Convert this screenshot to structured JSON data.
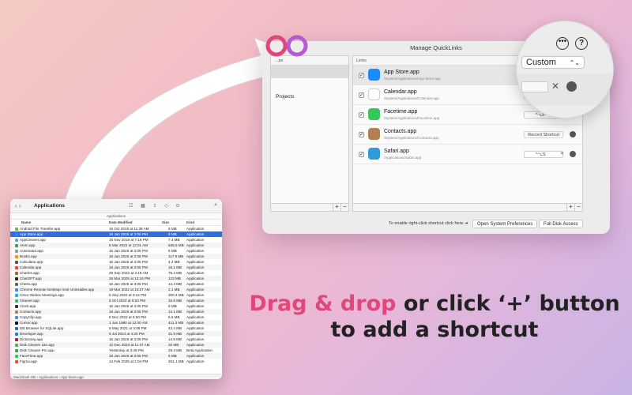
{
  "quicklinks": {
    "title": "Manage QuickLinks",
    "categories_header": "…ps",
    "categories": [
      {
        "label": "",
        "selected": true
      },
      {
        "label": "",
        "selected": false
      },
      {
        "label": "Projects",
        "selected": false
      }
    ],
    "links_header": "Links",
    "links": [
      {
        "name": "App Store.app",
        "path": "/System/Applications/App Store.app",
        "checked": true,
        "shortcut": "",
        "selected": true,
        "icon_color": "#1a8cff"
      },
      {
        "name": "Calendar.app",
        "path": "/System/Applications/Calendar.app",
        "checked": true,
        "shortcut": "",
        "selected": false,
        "icon_color": "#ffffff"
      },
      {
        "name": "Facetime.app",
        "path": "/System/Applications/Facetime.app",
        "checked": true,
        "shortcut": "^⌥F",
        "selected": false,
        "icon_color": "#34c759"
      },
      {
        "name": "Contacts.app",
        "path": "/System/Applications/Contacts.app",
        "checked": true,
        "shortcut": "Record Shortcut",
        "selected": false,
        "icon_color": "#b08050"
      },
      {
        "name": "Safari.app",
        "path": "/Applications/Safari.app",
        "checked": true,
        "shortcut": "^⌥S",
        "selected": false,
        "icon_color": "#2d9cdb"
      }
    ],
    "footer_text": "To enable right-click shortcut click here ➔",
    "open_prefs_label": "Open System Preferences",
    "full_disk_label": "Full Disk Access",
    "plus": "+",
    "minus": "−"
  },
  "zoom": {
    "more_icon": "•••",
    "help_icon": "?",
    "preset_value": "Custom",
    "clear_icon": "✕"
  },
  "finder": {
    "title": "Applications",
    "path_bar": "Applications",
    "columns": [
      "Name",
      "Date Modified",
      "Size",
      "Kind"
    ],
    "status_path": "Macintosh HD › Applications › App Store.app",
    "rows": [
      {
        "name": "Android File Transfer.app",
        "date": "16 Oct 2018 at 11:38 AM",
        "size": "6 MB",
        "kind": "Application",
        "sel": false,
        "color": "#7cb342"
      },
      {
        "name": "App Store.app",
        "date": "16 Jan 2025 at 3:05 PM",
        "size": "8 MB",
        "kind": "Application",
        "sel": true,
        "color": "#1a8cff"
      },
      {
        "name": "AppCleaner.app",
        "date": "16 Nov 2019 at 7:18 PM",
        "size": "7.4 MB",
        "kind": "Application",
        "sel": false,
        "color": "#5aa0e0"
      },
      {
        "name": "Atom.app",
        "date": "8 Mar 2022 at 12:01 AM",
        "size": "638.6 MB",
        "kind": "Application",
        "sel": false,
        "color": "#3d9970"
      },
      {
        "name": "Automator.app",
        "date": "16 Jan 2025 at 3:05 PM",
        "size": "5 MB",
        "kind": "Application",
        "sel": false,
        "color": "#999999"
      },
      {
        "name": "Books.app",
        "date": "16 Jan 2025 at 3:05 PM",
        "size": "117.9 MB",
        "kind": "Application",
        "sel": false,
        "color": "#ff9500"
      },
      {
        "name": "Calculator.app",
        "date": "16 Jan 2025 at 3:05 PM",
        "size": "4.2 MB",
        "kind": "Application",
        "sel": false,
        "color": "#555555"
      },
      {
        "name": "Calendar.app",
        "date": "16 Jan 2025 at 3:05 PM",
        "size": "16.1 MB",
        "kind": "Application",
        "sel": false,
        "color": "#ff3b30"
      },
      {
        "name": "Charles.app",
        "date": "29 Sep 2022 at 2:15 AM",
        "size": "75.4 MB",
        "kind": "Application",
        "sel": false,
        "color": "#8e6c3e"
      },
      {
        "name": "ChatGPT.app",
        "date": "26 Mar 2025 at 12:16 PM",
        "size": "123 MB",
        "kind": "Application",
        "sel": false,
        "color": "#222222"
      },
      {
        "name": "Chess.app",
        "date": "16 Jan 2025 at 3:05 PM",
        "size": "14.4 MB",
        "kind": "Application",
        "sel": false,
        "color": "#666666"
      },
      {
        "name": "Chrome Remote Desktop Host Uninstaller.app",
        "date": "19 Mar 2022 at 10:27 AM",
        "size": "2.1 MB",
        "kind": "Application",
        "sel": false,
        "color": "#4285f4"
      },
      {
        "name": "Cisco Webex Meetings.app",
        "date": "6 Sep 2022 at 3:12 PM",
        "size": "300.4 MB",
        "kind": "Application",
        "sel": false,
        "color": "#00bceb"
      },
      {
        "name": "Cleaner.app",
        "date": "6 Oct 2023 at 9:53 PM",
        "size": "15.5 MB",
        "kind": "Application",
        "sel": false,
        "color": "#3cb371"
      },
      {
        "name": "Clock.app",
        "date": "16 Jan 2025 at 3:05 PM",
        "size": "9 MB",
        "kind": "Application",
        "sel": false,
        "color": "#333333"
      },
      {
        "name": "Contacts.app",
        "date": "16 Jan 2025 at 3:05 PM",
        "size": "14.1 MB",
        "kind": "Application",
        "sel": false,
        "color": "#b08050"
      },
      {
        "name": "CopyClip.app",
        "date": "8 Dec 2022 at 5:50 PM",
        "size": "6.5 MB",
        "kind": "Application",
        "sel": false,
        "color": "#4a90d9"
      },
      {
        "name": "Cursor.app",
        "date": "1 Jan 1980 at 12:00 AM",
        "size": "411.3 MB",
        "kind": "Application",
        "sel": false,
        "color": "#111111"
      },
      {
        "name": "DB Browser for SQLite.app",
        "date": "9 May 2021 at 4:06 PM",
        "size": "43.4 MB",
        "kind": "Application",
        "sel": false,
        "color": "#2b6cb0"
      },
      {
        "name": "Developer.app",
        "date": "9 Jul 2024 at 4:20 PM",
        "size": "31.9 MB",
        "kind": "Application",
        "sel": false,
        "color": "#1c7ed6"
      },
      {
        "name": "Dictionary.app",
        "date": "16 Jan 2025 at 3:05 PM",
        "size": "14.6 MB",
        "kind": "Application",
        "sel": false,
        "color": "#9b2335"
      },
      {
        "name": "Disk Cleaner Lite.app",
        "date": "12 Dec 2023 at 11:37 AM",
        "size": "20 MB",
        "kind": "Application",
        "sel": false,
        "color": "#4caf50"
      },
      {
        "name": "Disk Cleaner Pro.app",
        "date": "Yesterday at 3:49 PM",
        "size": "29.3 MB",
        "kind": "Beta Application",
        "sel": false,
        "color": "#43a047"
      },
      {
        "name": "FaceTime.app",
        "date": "16 Jan 2025 at 3:05 PM",
        "size": "6 MB",
        "kind": "Application",
        "sel": false,
        "color": "#34c759"
      },
      {
        "name": "Figma.app",
        "date": "14 Feb 2025 at 1:04 PM",
        "size": "261.1 MB",
        "kind": "Application",
        "sel": false,
        "color": "#f24e1e"
      }
    ]
  },
  "headline": {
    "accent": "Drag & drop",
    "line1_rest": " or click ‘+’ button",
    "line2": "to add a shortcut"
  },
  "colors": {
    "accent": "#e0477a",
    "selection": "#2e6ee0"
  }
}
